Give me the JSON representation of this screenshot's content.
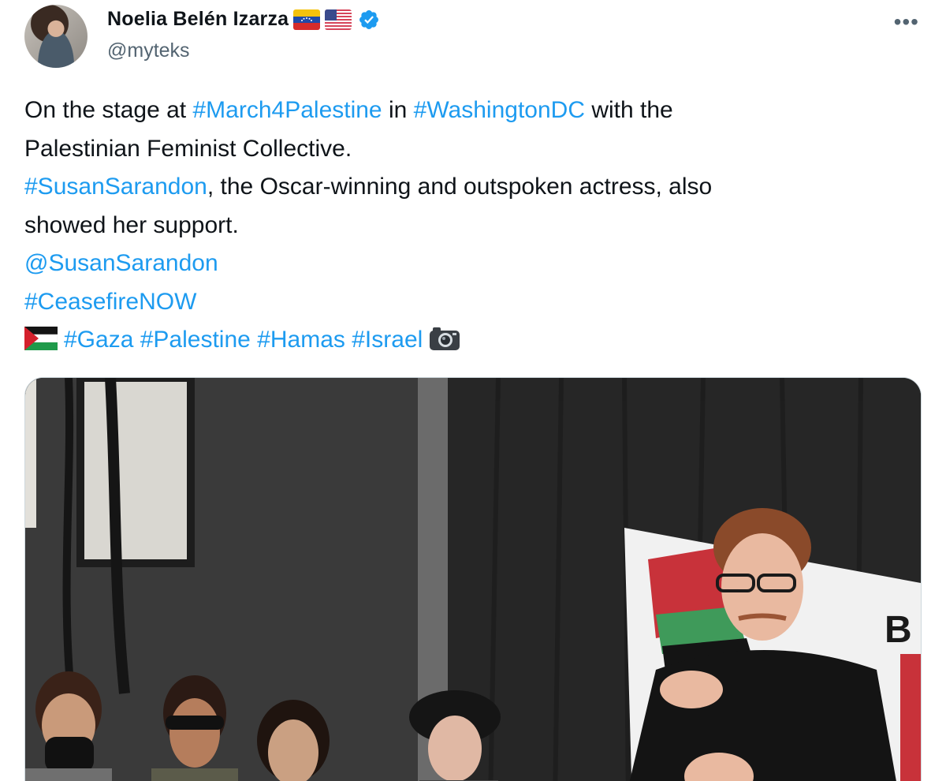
{
  "author": {
    "display_name": "Noelia Belén Izarza",
    "handle": "@myteks",
    "flags": [
      "venezuela-flag",
      "usa-flag"
    ],
    "verified": true
  },
  "more_label": "•••",
  "tweet": {
    "lines": [
      [
        {
          "text": "On the stage at ",
          "type": "plain"
        },
        {
          "text": "#March4Palestine",
          "type": "hashtag"
        },
        {
          "text": " in ",
          "type": "plain"
        },
        {
          "text": "#WashingtonDC",
          "type": "hashtag"
        },
        {
          "text": " with the",
          "type": "plain"
        }
      ],
      [
        {
          "text": "Palestinian  Feminist Collective.",
          "type": "plain"
        }
      ],
      [
        {
          "text": "#SusanSarandon",
          "type": "hashtag"
        },
        {
          "text": ", the Oscar-winning and outspoken actress, also",
          "type": "plain"
        }
      ],
      [
        {
          "text": "showed her  support.",
          "type": "plain"
        }
      ],
      [
        {
          "text": "@SusanSarandon",
          "type": "mention"
        }
      ],
      [
        {
          "text": "#CeasefireNOW",
          "type": "hashtag"
        }
      ],
      [
        {
          "text": "palestine-flag",
          "type": "emoji"
        },
        {
          "text": "#Gaza",
          "type": "hashtag"
        },
        {
          "text": " ",
          "type": "plain"
        },
        {
          "text": "#Palestine",
          "type": "hashtag"
        },
        {
          "text": " ",
          "type": "plain"
        },
        {
          "text": "#Hamas",
          "type": "hashtag"
        },
        {
          "text": " ",
          "type": "plain"
        },
        {
          "text": "#Israel",
          "type": "hashtag"
        },
        {
          "text": "camera-icon",
          "type": "emoji"
        }
      ]
    ]
  },
  "media": {
    "kind": "photo",
    "banner_text": "B"
  },
  "colors": {
    "link": "#1d9bf0",
    "text": "#0f1419",
    "secondary": "#536471",
    "verified": "#1d9bf0"
  }
}
